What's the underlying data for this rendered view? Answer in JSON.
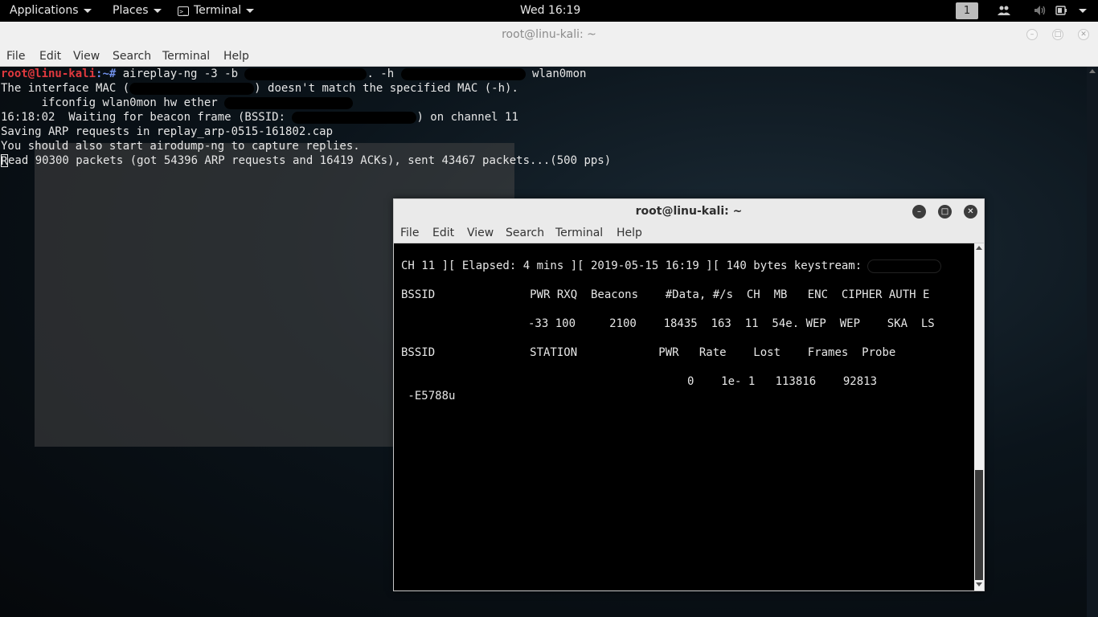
{
  "topbar": {
    "applications": "Applications",
    "places": "Places",
    "terminal": "Terminal",
    "clock": "Wed 16:19",
    "workspace": "1"
  },
  "main_window": {
    "title": "root@linu-kali: ~",
    "menu": [
      "File",
      "Edit",
      "View",
      "Search",
      "Terminal",
      "Help"
    ],
    "prompt_user": "root@linu-kali",
    "prompt_sep": ":~# ",
    "cmd_part1": "aireplay-ng -3 -b ",
    "cmd_part2": ". -h ",
    "cmd_part3": " wlan0mon",
    "line2_a": "The interface MAC (",
    "line2_b": ") doesn't match the specified MAC (-h).",
    "line3": "      ifconfig wlan0mon hw ether",
    "line4_a": "16:18:02  Waiting for beacon frame (BSSID: ",
    "line4_b": ") on channel 11",
    "line5": "Saving ARP requests in replay_arp-0515-161802.cap",
    "line6": "You should also start airodump-ng to capture replies.",
    "line7_r": "R",
    "line7": "ead 90300 packets (got 54396 ARP requests and 16419 ACKs), sent 43467 packets...(500 pps)"
  },
  "second_window": {
    "title": "root@linu-kali: ~",
    "menu": [
      "File",
      "Edit",
      "View",
      "Search",
      "Terminal",
      "Help"
    ],
    "status_line": "CH 11 ][ Elapsed: 4 mins ][ 2019-05-15 16:19 ][ 140 bytes keystream:",
    "ap_header": "BSSID              PWR RXQ  Beacons    #Data, #/s  CH  MB   ENC  CIPHER AUTH E",
    "ap_row": "-33 100     2100    18435  163  11  54e. WEP  WEP    SKA  LS",
    "sta_header": "BSSID              STATION            PWR   Rate    Lost    Frames  Probe",
    "sta_row": "0    1e- 1   113816    92813",
    "sta_probe": " -E5788u"
  },
  "colors": {
    "prompt_red": "#e0393e",
    "prompt_blue": "#6f8fe8",
    "terminal_text": "#e6e6e6"
  }
}
